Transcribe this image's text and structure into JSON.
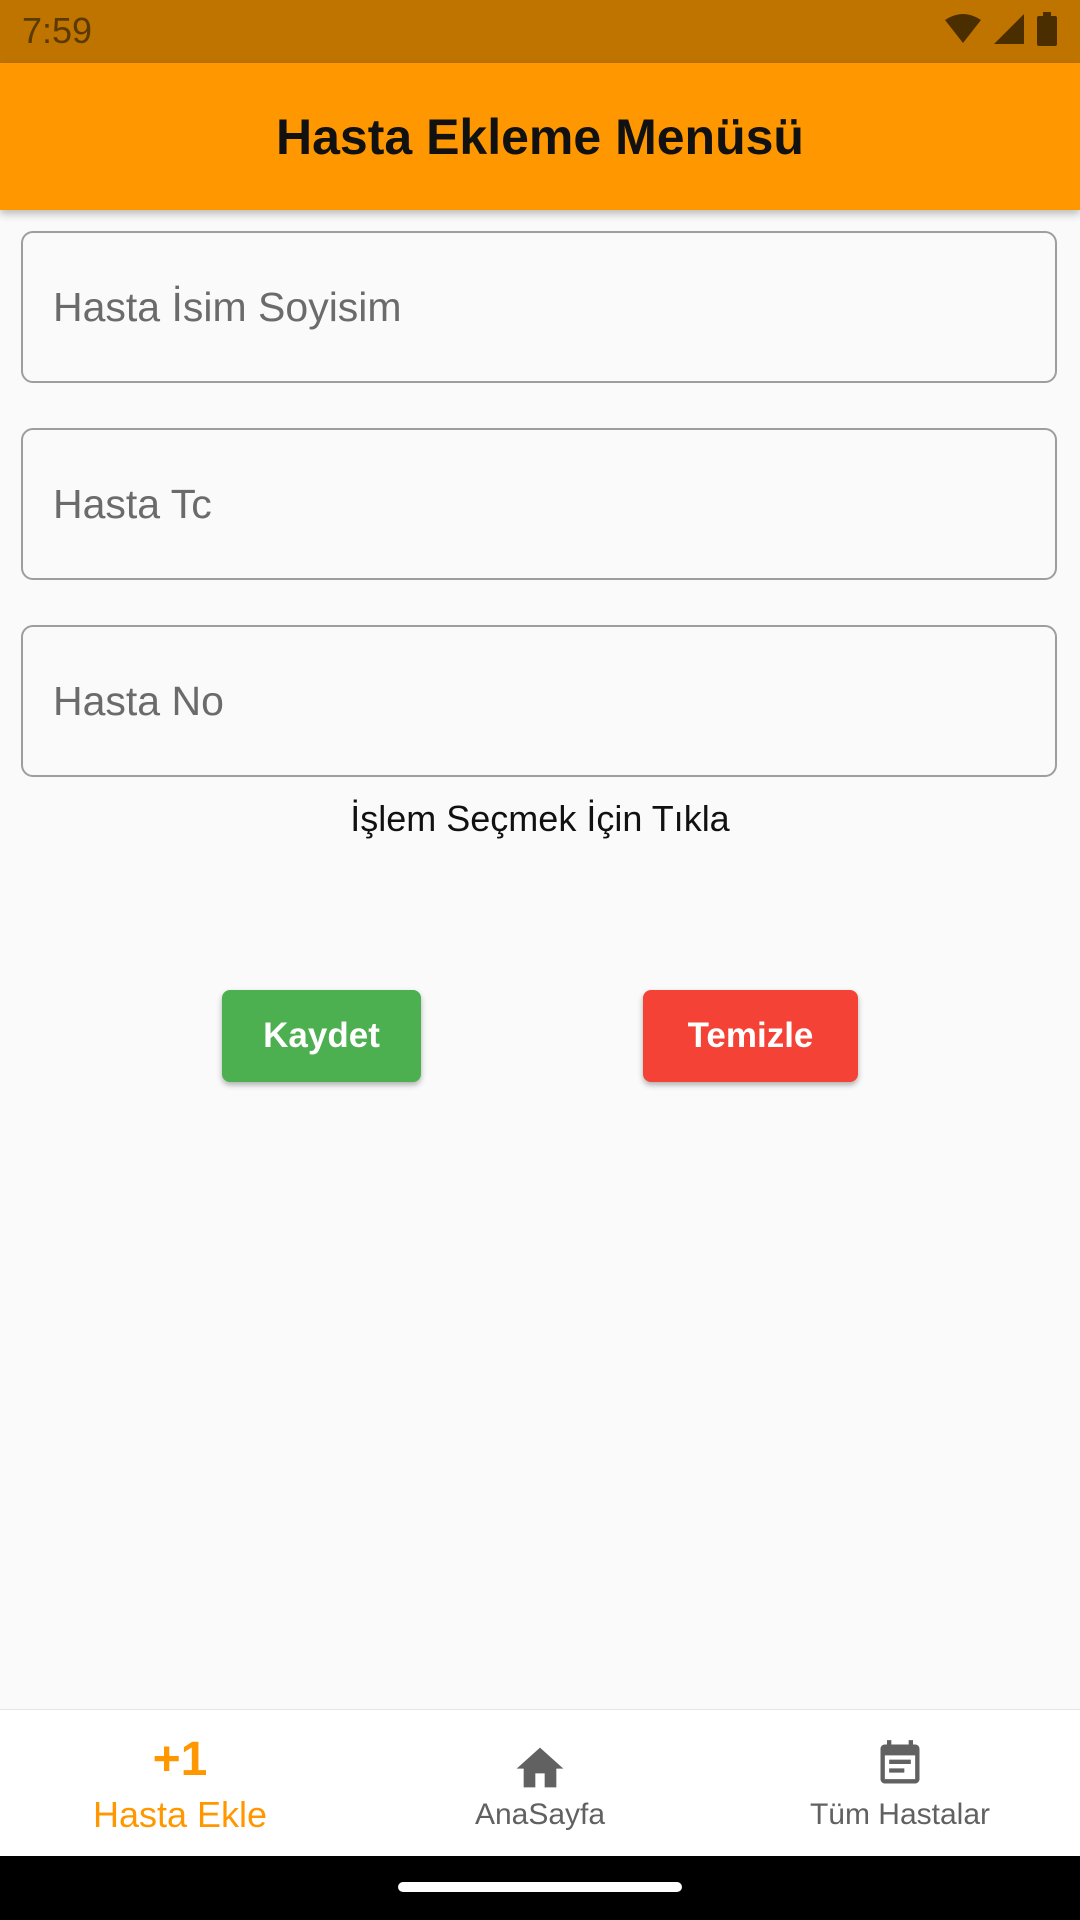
{
  "status_bar": {
    "time": "7:59",
    "icons": [
      "wifi-icon",
      "cell-signal-icon",
      "battery-icon"
    ],
    "background": "#c07400"
  },
  "app_bar": {
    "title": "Hasta Ekleme Menüsü",
    "background": "#ff9800"
  },
  "form": {
    "name_placeholder": "Hasta İsim Soyisim",
    "name_value": "",
    "tc_placeholder": "Hasta Tc",
    "tc_value": "",
    "no_placeholder": "Hasta No",
    "no_value": "",
    "operation_hint": "İşlem Seçmek İçin Tıkla"
  },
  "actions": {
    "save_label": "Kaydet",
    "save_color": "#4caf50",
    "clear_label": "Temizle",
    "clear_color": "#f44336"
  },
  "bottom_nav": {
    "items": [
      {
        "label": "Hasta Ekle",
        "icon": "plus-one-icon",
        "icon_text": "+1",
        "active": true
      },
      {
        "label": "AnaSayfa",
        "icon": "home-icon",
        "active": false
      },
      {
        "label": "Tüm Hastalar",
        "icon": "calendar-icon",
        "active": false
      }
    ],
    "active_color": "#ff9800"
  }
}
